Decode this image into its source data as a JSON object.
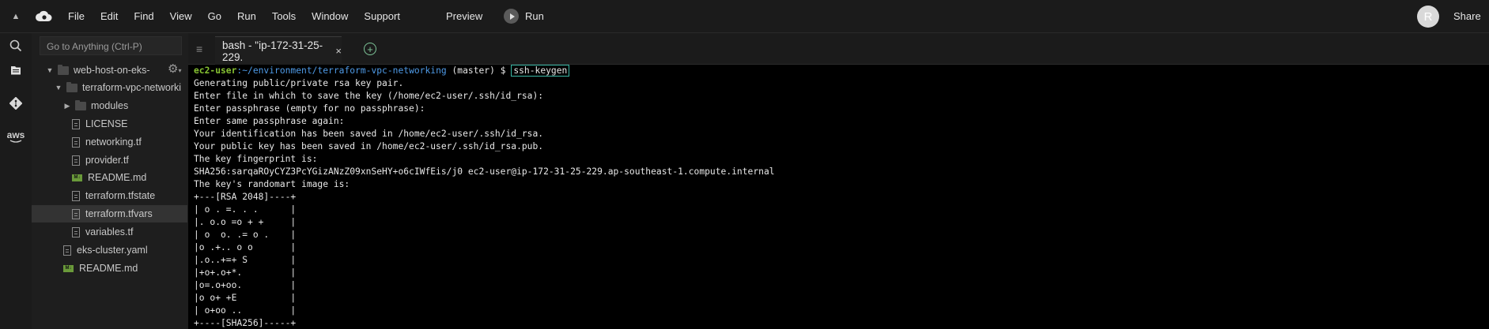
{
  "menubar": {
    "items": [
      "File",
      "Edit",
      "Find",
      "View",
      "Go",
      "Run",
      "Tools",
      "Window",
      "Support"
    ],
    "preview_label": "Preview",
    "run_label": "Run",
    "avatar_initial": "R",
    "share_label": "Share"
  },
  "activitybar": {
    "icons": [
      "search-icon",
      "files-icon",
      "git-icon",
      "aws-icon"
    ],
    "aws_label": "aws"
  },
  "explorer": {
    "goto_placeholder": "Go to Anything (Ctrl-P)",
    "items": [
      {
        "label": "web-host-on-eks-",
        "type": "folder",
        "open": true,
        "depth": 0
      },
      {
        "label": "terraform-vpc-networki",
        "type": "folder",
        "open": true,
        "depth": 1
      },
      {
        "label": "modules",
        "type": "folder",
        "open": false,
        "depth": 2
      },
      {
        "label": "LICENSE",
        "type": "file",
        "depth": 2
      },
      {
        "label": "networking.tf",
        "type": "file",
        "depth": 2
      },
      {
        "label": "provider.tf",
        "type": "file",
        "depth": 2
      },
      {
        "label": "README.md",
        "type": "md",
        "depth": 2
      },
      {
        "label": "terraform.tfstate",
        "type": "file",
        "depth": 2
      },
      {
        "label": "terraform.tfvars",
        "type": "file",
        "depth": 2,
        "selected": true
      },
      {
        "label": "variables.tf",
        "type": "file",
        "depth": 2
      },
      {
        "label": "eks-cluster.yaml",
        "type": "file",
        "depth": 1
      },
      {
        "label": "README.md",
        "type": "md",
        "depth": 1
      }
    ]
  },
  "tabs": [
    {
      "label": "bash - \"ip-172-31-25-229.",
      "close": "×"
    }
  ],
  "terminal": {
    "prompt_user": "ec2-user",
    "prompt_path": ":~/environment/terraform-vpc-networking",
    "prompt_branch": " (master) $ ",
    "command": "ssh-keygen",
    "lines": [
      "Generating public/private rsa key pair.",
      "Enter file in which to save the key (/home/ec2-user/.ssh/id_rsa):",
      "Enter passphrase (empty for no passphrase):",
      "Enter same passphrase again:",
      "Your identification has been saved in /home/ec2-user/.ssh/id_rsa.",
      "Your public key has been saved in /home/ec2-user/.ssh/id_rsa.pub.",
      "The key fingerprint is:",
      "SHA256:sarqaROyCYZ3PcYGizANzZ09xnSeHY+o6cIWfEis/j0 ec2-user@ip-172-31-25-229.ap-southeast-1.compute.internal",
      "The key's randomart image is:",
      "+---[RSA 2048]----+",
      "| o . =. . .      |",
      "|. o.o =o + +     |",
      "| o  o. .= o .    |",
      "|o .+.. o o       |",
      "|.o..+=+ S        |",
      "|+o+.o+*.         |",
      "|o=.o+oo.         |",
      "|o o+ +E          |",
      "| o+oo ..         |",
      "+----[SHA256]-----+"
    ]
  }
}
